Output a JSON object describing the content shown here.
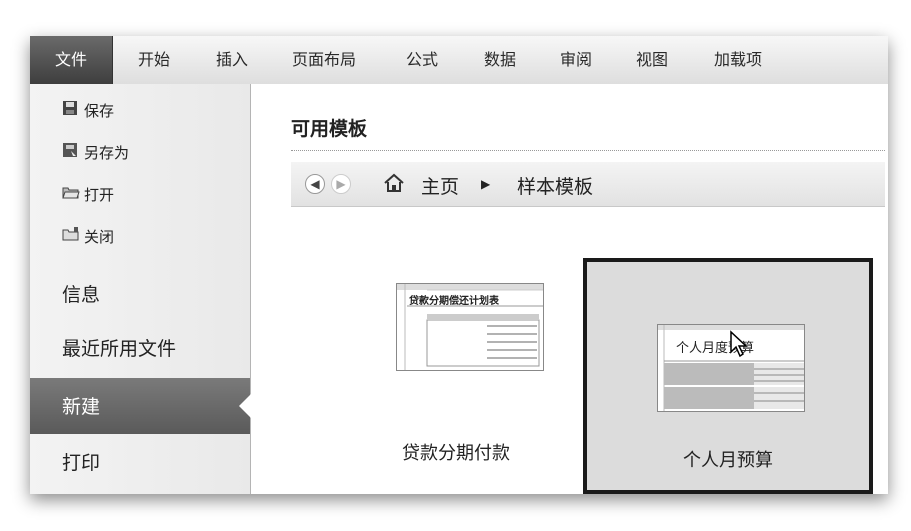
{
  "ribbon": {
    "tabs": [
      "文件",
      "开始",
      "插入",
      "页面布局",
      "公式",
      "数据",
      "审阅",
      "视图",
      "加载项"
    ]
  },
  "sidebar": {
    "small_items": [
      {
        "label": "保存",
        "icon": "save-icon"
      },
      {
        "label": "另存为",
        "icon": "save-as-icon"
      },
      {
        "label": "打开",
        "icon": "open-folder-icon"
      },
      {
        "label": "关闭",
        "icon": "close-folder-icon"
      }
    ],
    "info": "信息",
    "recent": "最近所用文件",
    "new": "新建",
    "print": "打印"
  },
  "main": {
    "heading": "可用模板",
    "nav": {
      "home": "主页",
      "current": "样本模板"
    },
    "templates": [
      {
        "caption": "贷款分期付款",
        "thumb_title": "贷款分期偿还计划表",
        "selected": false
      },
      {
        "caption": "个人月预算",
        "thumb_title": "个人月度预算",
        "selected": true
      }
    ]
  }
}
